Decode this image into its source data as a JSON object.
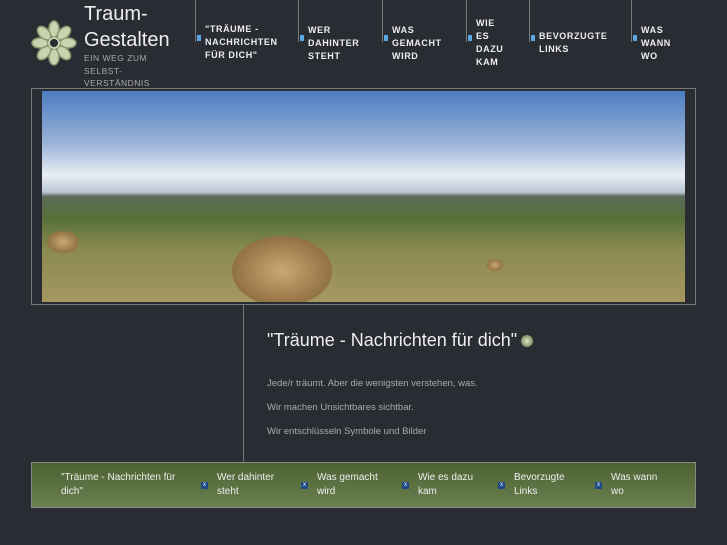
{
  "site": {
    "title_line1": "Traum-",
    "title_line2": "Gestalten",
    "subtitle": "EIN WEG ZUM SELBST-VERSTÄNDNIS"
  },
  "nav": [
    {
      "label": "\"TRÄUME -\nNACHRICHTEN\nFÜR DICH\""
    },
    {
      "label": "WER\nDAHINTER\nSTEHT"
    },
    {
      "label": "WAS\nGEMACHT\nWIRD"
    },
    {
      "label": "WIE\nES\nDAZU\nKAM"
    },
    {
      "label": "BEVORZUGTE\nLINKS"
    },
    {
      "label": "WAS\nWANN\nWO"
    }
  ],
  "main": {
    "heading": "\"Träume - Nachrichten für dich\"",
    "paragraphs": [
      "Jede/r träumt. Aber die wenigsten verstehen, was.",
      "Wir machen Unsichtbares sichtbar.",
      "Wir entschlüsseln Symbole und Bilder"
    ]
  },
  "footer": [
    {
      "label": "\"Träume - Nachrichten für dich\""
    },
    {
      "label": "Wer dahinter steht"
    },
    {
      "label": "Was gemacht wird"
    },
    {
      "label": "Wie es dazu kam"
    },
    {
      "label": "Bevorzugte Links"
    },
    {
      "label": "Was wann wo"
    }
  ],
  "icons": {
    "footer_sep": "x"
  }
}
